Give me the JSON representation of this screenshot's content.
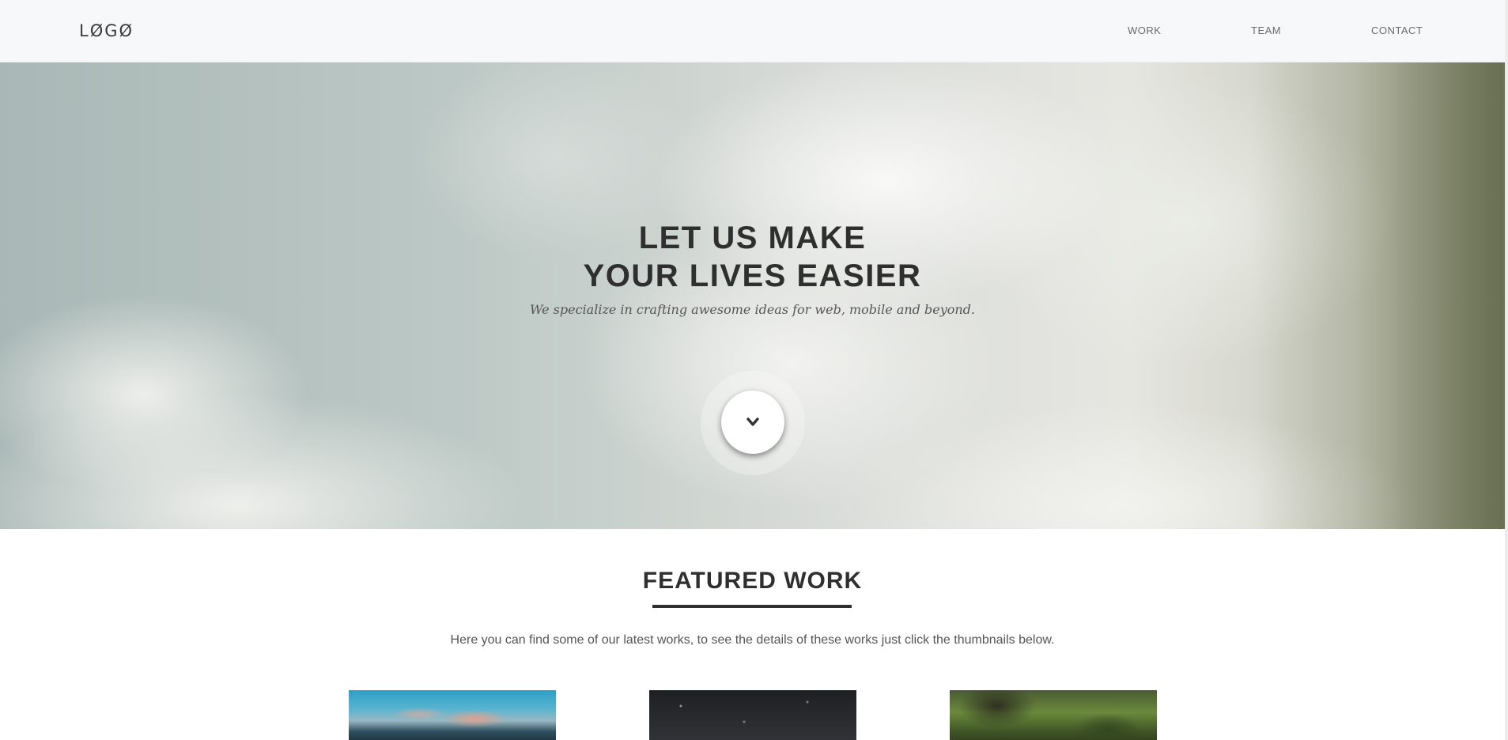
{
  "header": {
    "logo": "LØGØ",
    "nav": {
      "work": "WORK",
      "team": "TEAM",
      "contact": "CONTACT"
    }
  },
  "hero": {
    "title_line1": "LET US MAKE",
    "title_line2": "YOUR LIVES EASIER",
    "subtitle": "We specialize in crafting awesome ideas for web, mobile and beyond.",
    "scroll_icon": "chevron-down-icon"
  },
  "featured": {
    "title": "FEATURED WORK",
    "description": "Here you can find some of our latest works, to see the details of these works just click the thumbnails below.",
    "thumbnails": [
      "mountain-sky-photo",
      "night-sky-photo",
      "tree-photo"
    ]
  },
  "colors": {
    "header_bg": "#f7f8f9",
    "text_dark": "#2f2f2f",
    "text_muted": "#555555"
  }
}
